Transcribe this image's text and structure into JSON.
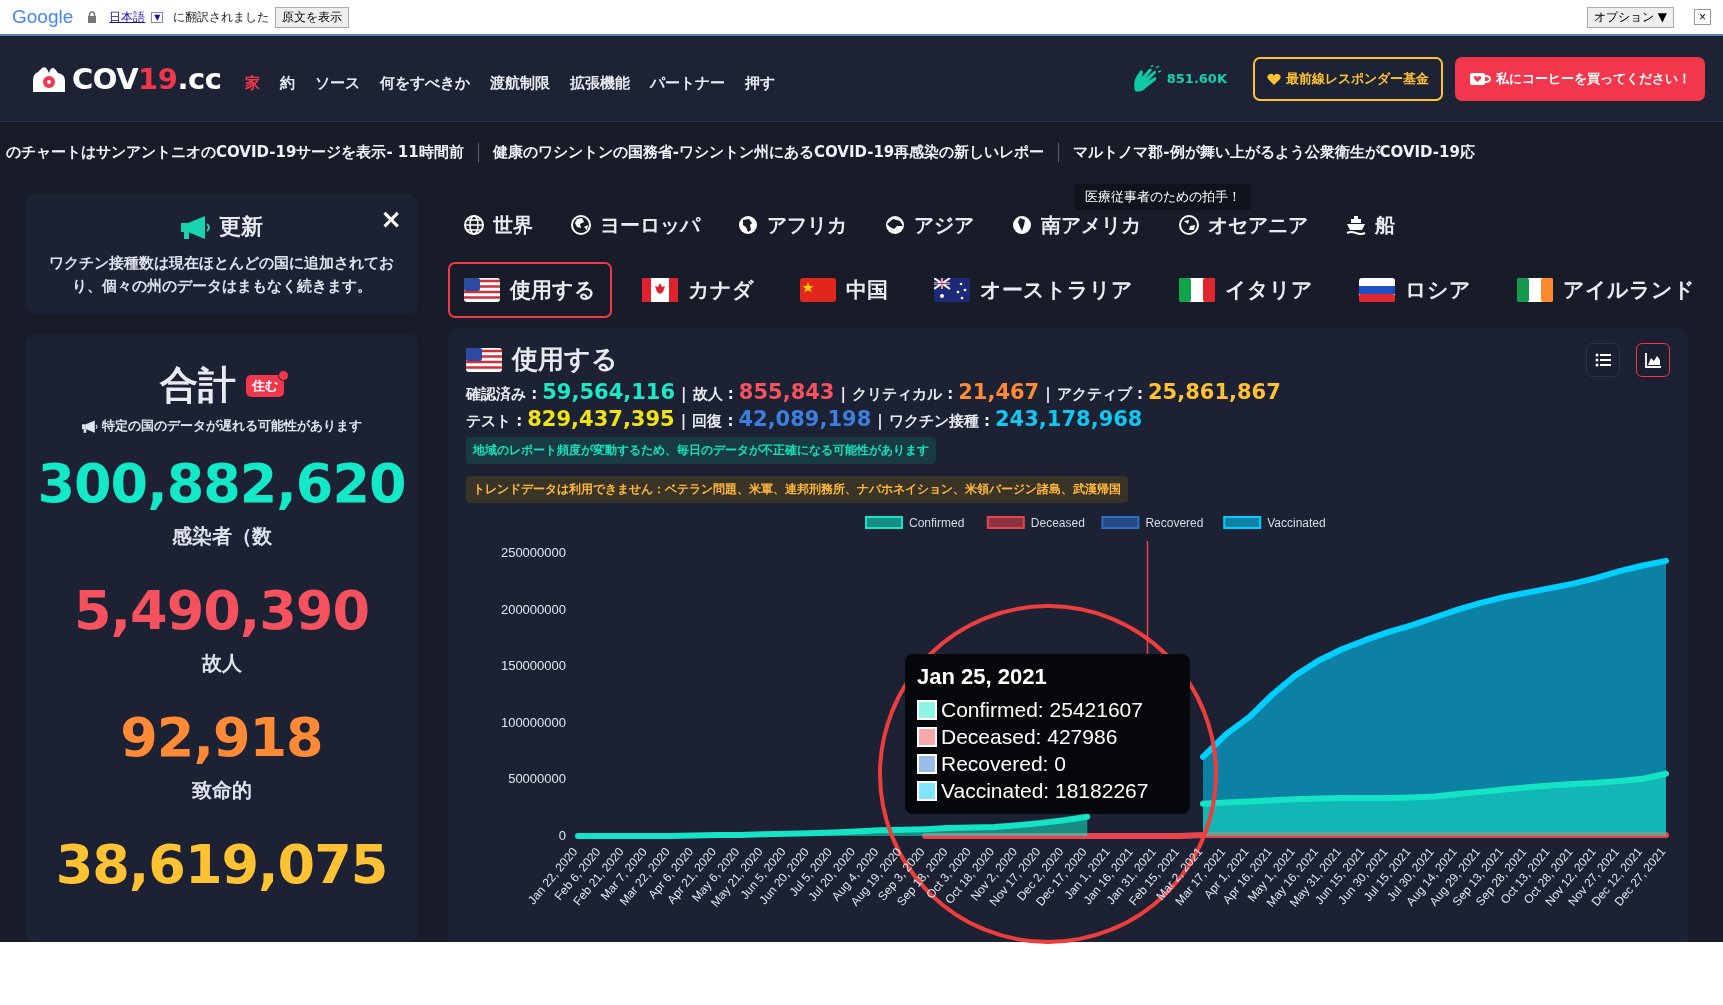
{
  "translate_bar": {
    "logo": "Google",
    "language_link": "日本語",
    "dropdown": "▼",
    "message": "に翻訳されました",
    "show_original_button": "原文を表示",
    "options_button": "オプション ▼",
    "close": "×"
  },
  "header": {
    "logo": {
      "part_1": "COV",
      "part_2": "19",
      "part_3": ".cc"
    },
    "nav": [
      {
        "label": "家",
        "selected": true
      },
      {
        "label": "約",
        "selected": false
      },
      {
        "label": "ソース",
        "selected": false
      },
      {
        "label": "何をすべきか",
        "selected": false
      },
      {
        "label": "渡航制限",
        "selected": false
      },
      {
        "label": "拡張機能",
        "selected": false
      },
      {
        "label": "パートナー",
        "selected": false
      },
      {
        "label": "押す",
        "selected": false
      }
    ],
    "applause_count": "851.60K",
    "buttons": [
      {
        "label": "最前線レスポンダー基金",
        "kind": "outline"
      },
      {
        "label": "私にコーヒーを買ってください！",
        "kind": "filled"
      }
    ]
  },
  "ticker": {
    "items": [
      "のチャートはサンアントニオのCOVID-19サージを表示- 11時間前",
      "健康のワシントンの国務省-ワシントン州にあるCOVID-19再感染の新しいレポー",
      "マルトノマ郡-例が舞い上がるよう公衆衛生がCOVID-19応"
    ],
    "tooltip": "医療従事者のための拍手！"
  },
  "update_card": {
    "title": "更新",
    "close": "×",
    "text": "ワクチン接種数は現在ほとんどの国に追加されており、個々の州のデータはまもなく続きます。"
  },
  "totals_card": {
    "title": "合計",
    "badge": "住む",
    "note": "特定の国のデータが遅れる可能性があります",
    "stats": [
      {
        "value": "300,882,620",
        "label": "感染者（数",
        "color": "#13e8c8"
      },
      {
        "value": "5,490,390",
        "label": "故人",
        "color": "#f5515f"
      },
      {
        "value": "92,918",
        "label": "致命的",
        "color": "#ff8a35"
      },
      {
        "value": "38,619,075",
        "color": "#ffc233"
      }
    ]
  },
  "region_tabs": [
    {
      "label": "世界",
      "selected": false
    },
    {
      "label": "ヨーロッパ",
      "selected": false
    },
    {
      "label": "アフリカ",
      "selected": false
    },
    {
      "label": "アジア",
      "selected": false
    },
    {
      "label": "南アメリカ",
      "selected": false
    },
    {
      "label": "オセアニア",
      "selected": false
    },
    {
      "label": "船",
      "selected": false
    }
  ],
  "country_tabs": [
    {
      "label": "使用する",
      "selected": true
    },
    {
      "label": "カナダ",
      "selected": false
    },
    {
      "label": "中国",
      "selected": false
    },
    {
      "label": "オーストラリア",
      "selected": false
    },
    {
      "label": "イタリア",
      "selected": false
    },
    {
      "label": "ロシア",
      "selected": false
    },
    {
      "label": "アイルランド",
      "selected": false
    }
  ],
  "country_panel": {
    "title": "使用する",
    "separator": "|",
    "stats_rows": [
      [
        {
          "label": "確認済み :",
          "value": "59,564,116",
          "color": "#1de9c6"
        },
        {
          "label": "故人 :",
          "value": "855,843",
          "color": "#f5515f"
        },
        {
          "label": "クリティカル :",
          "value": "21,467",
          "color": "#ff8a35"
        },
        {
          "label": "アクティブ :",
          "value": "25,861,867",
          "color": "#ffc233"
        }
      ],
      [
        {
          "label": "テスト :",
          "value": "829,437,395",
          "color": "#f2e313"
        },
        {
          "label": "回復 :",
          "value": "42,089,198",
          "color": "#3d7fe0"
        },
        {
          "label": "ワクチン接種 :",
          "value": "243,178,968",
          "color": "#11c8f2"
        }
      ]
    ],
    "notices": [
      {
        "text": "地域のレポート頻度が変動するため、毎日のデータが不正確になる可能性があります",
        "kind": "info"
      },
      {
        "text": "トレンドデータは利用できません：ベテラン問題、米軍、連邦刑務所、ナバホネイション、米領バージン諸島、武漢帰国",
        "kind": "warning"
      }
    ],
    "view_buttons": [
      {
        "kind": "list",
        "selected": false
      },
      {
        "kind": "chart",
        "selected": true
      }
    ],
    "chart_data": {
      "type": "area",
      "stacked": false,
      "categories": [
        "Jan 22, 2020",
        "Feb 6, 2020",
        "Feb 21, 2020",
        "Mar 7, 2020",
        "Mar 22, 2020",
        "Apr 6, 2020",
        "Apr 21, 2020",
        "May 6, 2020",
        "May 21, 2020",
        "Jun 5, 2020",
        "Jun 20, 2020",
        "Jul 5, 2020",
        "Jul 20, 2020",
        "Aug 4, 2020",
        "Aug 19, 2020",
        "Sep 3, 2020",
        "Sep 18, 2020",
        "Oct 3, 2020",
        "Oct 18, 2020",
        "Nov 2, 2020",
        "Nov 17, 2020",
        "Dec 2, 2020",
        "Dec 17, 2020",
        "Jan 1, 2021",
        "Jan 16, 2021",
        "Jan 31, 2021",
        "Feb 15, 2021",
        "Mar 2, 2021",
        "Mar 17, 2021",
        "Apr 1, 2021",
        "Apr 16, 2021",
        "May 1, 2021",
        "May 16, 2021",
        "May 31, 2021",
        "Jun 15, 2021",
        "Jun 30, 2021",
        "Jul 15, 2021",
        "Jul 30, 2021",
        "Aug 14, 2021",
        "Aug 29, 2021",
        "Sep 13, 2021",
        "Sep 28, 2021",
        "Oct 13, 2021",
        "Oct 28, 2021",
        "Nov 12, 2021",
        "Nov 27, 2021",
        "Dec 12, 2021",
        "Dec 27, 2021"
      ],
      "series": [
        {
          "name": "Confirmed",
          "color": "#14e3c5",
          "values": [
            0,
            0,
            0,
            0,
            0,
            500000,
            1000000,
            1000000,
            1500000,
            2000000,
            2500000,
            3000000,
            4000000,
            5000000,
            5500000,
            6000000,
            7000000,
            7500000,
            8000000,
            9500000,
            11500000,
            14000000,
            17000000,
            null,
            null,
            null,
            null,
            28500000,
            29500000,
            30500000,
            31500000,
            32500000,
            33000000,
            33500000,
            33500000,
            33500000,
            34000000,
            35000000,
            37000000,
            39000000,
            41000000,
            43000000,
            44500000,
            46000000,
            47000000,
            48500000,
            50500000,
            55000000
          ]
        },
        {
          "name": "Deceased",
          "color": "#e8434d",
          "values": [
            null,
            null,
            null,
            null,
            null,
            null,
            null,
            null,
            null,
            null,
            null,
            null,
            null,
            null,
            null,
            0,
            0,
            0,
            0,
            0,
            0,
            0,
            0,
            0,
            0,
            0,
            0,
            1000000,
            1000000,
            1000000,
            1000000,
            1000000,
            1000000,
            1000000,
            1000000,
            1000000,
            1000000,
            1000000,
            1000000,
            1000000,
            1000000,
            1000000,
            1000000,
            1000000,
            1000000,
            1000000,
            1000000,
            1000000
          ]
        },
        {
          "name": "Recovered",
          "color": "#2f6cc4",
          "values": [
            null,
            null,
            null,
            null,
            null,
            null,
            null,
            null,
            null,
            null,
            null,
            null,
            null,
            null,
            null,
            null,
            null,
            null,
            null,
            null,
            null,
            null,
            null,
            null,
            null,
            null,
            null,
            null,
            null,
            null,
            null,
            null,
            null,
            null,
            null,
            null,
            null,
            null,
            null,
            null,
            null,
            null,
            null,
            null,
            null,
            null,
            null,
            null
          ]
        },
        {
          "name": "Vaccinated",
          "color": "#00cfff",
          "values": [
            null,
            null,
            null,
            null,
            null,
            null,
            null,
            null,
            null,
            null,
            null,
            null,
            null,
            null,
            null,
            null,
            null,
            null,
            null,
            null,
            null,
            null,
            null,
            null,
            null,
            null,
            null,
            70000000,
            90000000,
            105000000,
            125000000,
            142000000,
            155000000,
            165000000,
            173000000,
            180000000,
            186000000,
            193000000,
            200000000,
            206000000,
            211000000,
            215000000,
            219000000,
            223000000,
            228000000,
            234000000,
            239000000,
            243000000
          ]
        }
      ],
      "legend": "top",
      "ylim": [
        0,
        250000000
      ],
      "yticks": [
        0,
        50000000,
        100000000,
        150000000,
        200000000,
        250000000
      ]
    },
    "hover_tooltip": {
      "title": "Jan 25, 2021",
      "items": [
        {
          "text": "Confirmed: 25421607",
          "color": "#8cf5e4"
        },
        {
          "text": "Deceased: 427986",
          "color": "#f8a7a9"
        },
        {
          "text": "Recovered: 0",
          "color": "#9bbbe8"
        },
        {
          "text": "Vaccinated: 18182267",
          "color": "#80e5fa"
        }
      ]
    }
  }
}
